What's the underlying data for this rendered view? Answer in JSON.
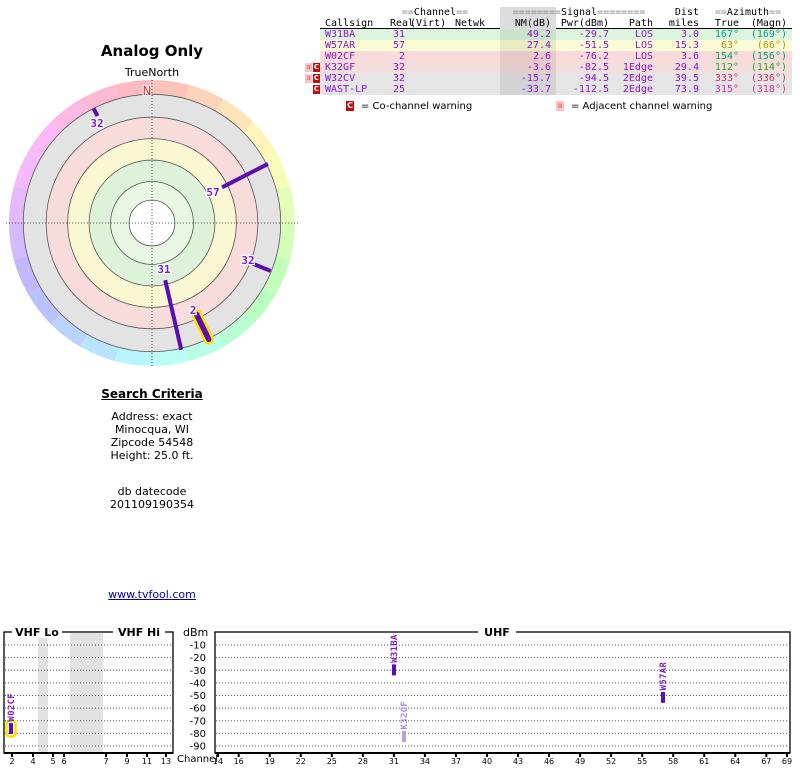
{
  "colors": {
    "purple": "#8a15cc",
    "marker": "#5a0fae",
    "marker_faded": "#c09ae2",
    "label_faded": "#b68adc",
    "label_purple": "#7a1fc0",
    "highlight": "#ffe000",
    "link": "#0000bb",
    "north": "#dd2222",
    "warn_red": "#c40c0c",
    "warn_pink": "#ffc2c2"
  },
  "radar": {
    "title": "Analog Only",
    "north_label": "TrueNorth",
    "n_label": "N",
    "rings": [
      {
        "r": 0.16,
        "color": "#ffffff"
      },
      {
        "r": 0.29,
        "color": "#e9f6e4"
      },
      {
        "r": 0.44,
        "color": "#def1d9"
      },
      {
        "r": 0.59,
        "color": "#faf8d2"
      },
      {
        "r": 0.74,
        "color": "#f8dcdc"
      },
      {
        "r": 0.9,
        "color": "#e3e3e3"
      }
    ],
    "stations": [
      {
        "label": "31",
        "callsign": "W31BA",
        "azimuth": 167,
        "r0": 0.41,
        "r1": 0.91,
        "highlighted": false,
        "lx": 164,
        "ly": 273
      },
      {
        "label": "57",
        "callsign": "W57AR",
        "azimuth": 63,
        "r0": 0.55,
        "r1": 0.91,
        "highlighted": false,
        "lx": 213,
        "ly": 196
      },
      {
        "label": "2",
        "callsign": "W02CF",
        "azimuth": 154,
        "r0": 0.71,
        "r1": 0.905,
        "highlighted": true,
        "lx": 193,
        "ly": 314
      },
      {
        "label": "32",
        "callsign": "K32GF",
        "azimuth": 112,
        "r0": 0.75,
        "r1": 0.895,
        "highlighted": false,
        "lx": 248,
        "ly": 264
      },
      {
        "label": "32",
        "callsign": "W32CV",
        "azimuth": 333,
        "r0": 0.84,
        "r1": 0.9,
        "highlighted": false,
        "lx": 97,
        "ly": 127
      }
    ]
  },
  "table": {
    "groups": {
      "channel": {
        "pre": "==",
        "label": "Channel",
        "post": "=="
      },
      "signal": {
        "pre": "========",
        "label": "Signal",
        "post": "========"
      },
      "dist": {
        "label": "Dist"
      },
      "azimuth": {
        "pre": "==",
        "label": "Azimuth",
        "post": "=="
      }
    },
    "columns": {
      "callsign": "Callsign",
      "real": "Real",
      "virt": "(Virt)",
      "netwk": "Netwk",
      "nm": "NM(dB)",
      "pwr": "Pwr(dBm)",
      "path": "Path",
      "miles": "miles",
      "true": "True",
      "magn": "(Magn)"
    },
    "rows": [
      {
        "callsign": "W31BA",
        "real": "31",
        "virt": "",
        "netwk": "",
        "nm": "49.2",
        "pwr": "-29.7",
        "path": "LOS",
        "miles": "3.0",
        "true": "167°",
        "magn": "(169°)",
        "row_color": "#ddf3dd",
        "nm_color": "#cbe2cb",
        "az_color": "#00a089",
        "magn_color": "#00a089",
        "warnings": []
      },
      {
        "callsign": "W57AR",
        "real": "57",
        "virt": "",
        "netwk": "",
        "nm": "27.4",
        "pwr": "-51.5",
        "path": "LOS",
        "miles": "15.3",
        "true": "63°",
        "magn": "(66°)",
        "row_color": "#fbfbd6",
        "nm_color": "#e9e9c4",
        "az_color": "#ab9500",
        "magn_color": "#b09a00",
        "warnings": []
      },
      {
        "callsign": "W02CF",
        "real": "2",
        "virt": "",
        "netwk": "",
        "nm": "2.6",
        "pwr": "-76.2",
        "path": "LOS",
        "miles": "3.6",
        "true": "154°",
        "magn": "(156°)",
        "row_color": "#fadbdb",
        "nm_color": "#e8c9c9",
        "az_color": "#00a55e",
        "magn_color": "#009f73",
        "warnings": []
      },
      {
        "callsign": "K32GF",
        "real": "32",
        "virt": "",
        "netwk": "",
        "nm": "-3.6",
        "pwr": "-82.5",
        "path": "1Edge",
        "miles": "29.4",
        "true": "112°",
        "magn": "(114°)",
        "row_color": "#f3dede",
        "nm_color": "#e1cbcb",
        "az_color": "#33a516",
        "magn_color": "#2da31c",
        "warnings": [
          "a",
          "C"
        ]
      },
      {
        "callsign": "W32CV",
        "real": "32",
        "virt": "",
        "netwk": "",
        "nm": "-15.7",
        "pwr": "-94.5",
        "path": "2Edge",
        "miles": "39.5",
        "true": "333°",
        "magn": "(336°)",
        "row_color": "#e5e5e5",
        "nm_color": "#d3d3d3",
        "az_color": "#cc3366",
        "magn_color": "#cc335e",
        "warnings": [
          "a",
          "C"
        ]
      },
      {
        "callsign": "WAST-LP",
        "real": "25",
        "virt": "",
        "netwk": "",
        "nm": "-33.7",
        "pwr": "-112.5",
        "path": "2Edge",
        "miles": "73.9",
        "true": "315°",
        "magn": "(318°)",
        "row_color": "#e5e5e5",
        "nm_color": "#d3d3d3",
        "az_color": "#cc3399",
        "magn_color": "#c63a8e",
        "warnings": [
          "C"
        ]
      }
    ]
  },
  "legend": {
    "co": {
      "symbol": "C",
      "text": "=  Co-channel warning"
    },
    "adj": {
      "symbol": "a",
      "text": "=  Adjacent channel warning"
    }
  },
  "search": {
    "heading": "Search Criteria",
    "lines": [
      "Address: exact",
      "Minocqua, WI",
      "Zipcode 54548",
      "Height: 25.0 ft."
    ],
    "db_label": "db datecode",
    "db_value": "201109190354"
  },
  "link": {
    "text": "www.tvfool.com"
  },
  "spectrum": {
    "y_axis_label": "dBm",
    "x_axis_label": "Channel",
    "y_ticks": [
      "-10",
      "-20",
      "-30",
      "-40",
      "-50",
      "-60",
      "-70",
      "-80",
      "-90"
    ],
    "sections": {
      "vhf_lo": "VHF Lo",
      "vhf_hi": "VHF Hi",
      "uhf": "UHF"
    },
    "gray_bands": [
      [
        38,
        48
      ],
      [
        70,
        103
      ]
    ],
    "left_ticks": [
      {
        "ch": "2",
        "x": 12
      },
      {
        "ch": "4",
        "x": 33
      },
      {
        "ch": "5",
        "x": 53
      },
      {
        "ch": "6",
        "x": 64
      },
      {
        "ch": "7",
        "x": 106
      },
      {
        "ch": "9",
        "x": 127
      },
      {
        "ch": "11",
        "x": 147
      },
      {
        "ch": "13",
        "x": 166
      }
    ],
    "right_ticks": [
      "14",
      "16",
      "19",
      "22",
      "25",
      "28",
      "31",
      "34",
      "37",
      "40",
      "43",
      "46",
      "49",
      "52",
      "55",
      "58",
      "61",
      "64",
      "67",
      "69"
    ],
    "markers": [
      {
        "callsign": "W02CF",
        "channel": 2,
        "dbm": -76.2,
        "x": 11,
        "faded": false,
        "highlighted": true
      },
      {
        "callsign": "W31BA",
        "channel": 31,
        "dbm": -29.7,
        "x": 394,
        "faded": false,
        "highlighted": false
      },
      {
        "callsign": "K32GF",
        "channel": 32,
        "dbm": -82.5,
        "x": 404,
        "faded": true,
        "highlighted": false
      },
      {
        "callsign": "W57AR",
        "channel": 57,
        "dbm": -51.5,
        "x": 663,
        "faded": false,
        "highlighted": false
      }
    ]
  },
  "chart_data": [
    {
      "type": "polar",
      "title": "Analog Only",
      "north_reference": "TrueNorth",
      "stations": [
        {
          "callsign": "W31BA",
          "channel": 31,
          "azimuth_true_deg": 167,
          "nm_db": 49.2,
          "r_inner_frac": 0.41,
          "r_outer_frac": 0.91,
          "highlighted": false
        },
        {
          "callsign": "W57AR",
          "channel": 57,
          "azimuth_true_deg": 63,
          "nm_db": 27.4,
          "r_inner_frac": 0.55,
          "r_outer_frac": 0.91,
          "highlighted": false
        },
        {
          "callsign": "W02CF",
          "channel": 2,
          "azimuth_true_deg": 154,
          "nm_db": 2.6,
          "r_inner_frac": 0.71,
          "r_outer_frac": 0.905,
          "highlighted": true
        },
        {
          "callsign": "K32GF",
          "channel": 32,
          "azimuth_true_deg": 112,
          "nm_db": -3.6,
          "r_inner_frac": 0.75,
          "r_outer_frac": 0.895,
          "highlighted": false
        },
        {
          "callsign": "W32CV",
          "channel": 32,
          "azimuth_true_deg": 333,
          "nm_db": -15.7,
          "r_inner_frac": 0.84,
          "r_outer_frac": 0.9,
          "highlighted": false
        }
      ]
    },
    {
      "type": "scatter",
      "title": "Channel vs Pwr(dBm)",
      "xlabel": "Channel",
      "ylabel": "dBm",
      "ylim": [
        -95,
        -5
      ],
      "x_sections": [
        "VHF Lo (2-6)",
        "VHF Hi (7-13)",
        "UHF (14-69)"
      ],
      "points": [
        {
          "callsign": "W02CF",
          "x": 2,
          "y": -76.2
        },
        {
          "callsign": "W31BA",
          "x": 31,
          "y": -29.7
        },
        {
          "callsign": "K32GF",
          "x": 32,
          "y": -82.5
        },
        {
          "callsign": "W57AR",
          "x": 57,
          "y": -51.5
        }
      ]
    }
  ]
}
